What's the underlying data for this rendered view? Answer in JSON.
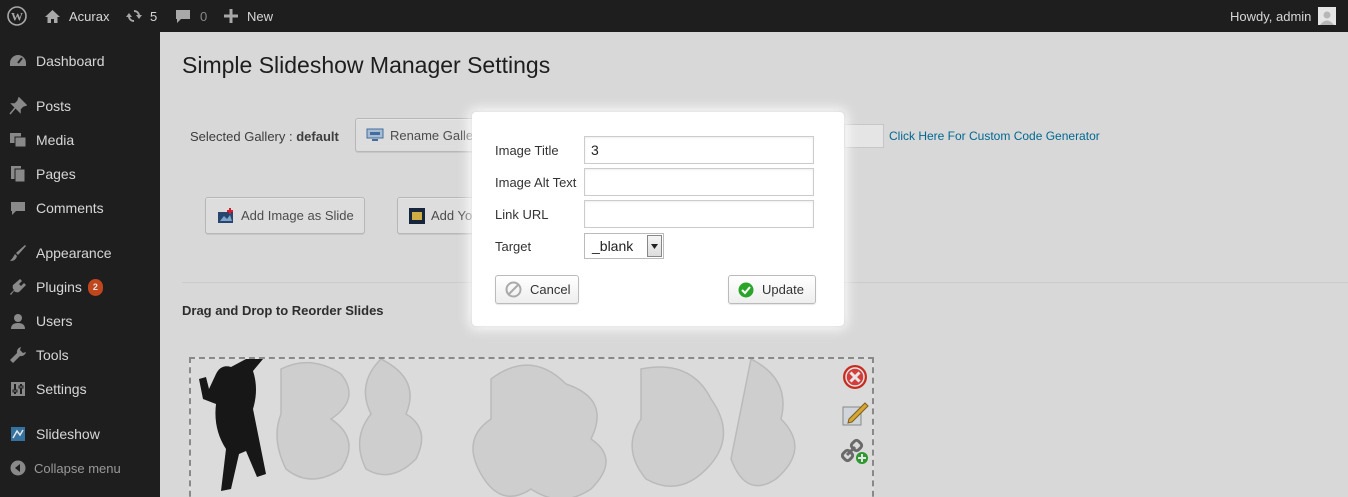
{
  "adminbar": {
    "site_name": "Acurax",
    "updates_count": "5",
    "comments_count": "0",
    "new_label": "New",
    "greeting": "Howdy, admin"
  },
  "sidebar": {
    "items": [
      {
        "label": "Dashboard",
        "icon": "dashboard-icon"
      },
      {
        "label": "Posts",
        "icon": "pin-icon"
      },
      {
        "label": "Media",
        "icon": "media-icon"
      },
      {
        "label": "Pages",
        "icon": "pages-icon"
      },
      {
        "label": "Comments",
        "icon": "comment-icon"
      },
      {
        "label": "Appearance",
        "icon": "brush-icon"
      },
      {
        "label": "Plugins",
        "icon": "plugin-icon",
        "badge": "2"
      },
      {
        "label": "Users",
        "icon": "user-icon"
      },
      {
        "label": "Tools",
        "icon": "wrench-icon"
      },
      {
        "label": "Settings",
        "icon": "settings-icon"
      },
      {
        "label": "Slideshow",
        "icon": "slideshow-icon"
      }
    ],
    "collapse_label": "Collapse menu"
  },
  "main": {
    "title": "Simple Slideshow Manager Settings",
    "selected_gallery_label": "Selected Gallery :",
    "selected_gallery_value": "default",
    "rename_button": "Rename Gallery",
    "code_generator_link": "Click Here For Custom Code Generator",
    "add_image_button": "Add Image as Slide",
    "add_video_button": "Add Youtube Video as Slide",
    "reorder_title": "Drag and Drop to Reorder Slides"
  },
  "modal": {
    "title_label": "Image Title",
    "title_value": "3",
    "alt_label": "Image Alt Text",
    "alt_value": "",
    "link_label": "Link URL",
    "link_value": "",
    "target_label": "Target",
    "target_value": "_blank",
    "cancel_label": "Cancel",
    "update_label": "Update"
  },
  "colors": {
    "adminbar_bg": "#222222",
    "accent_link": "#0074a2",
    "badge": "#d54e21"
  }
}
